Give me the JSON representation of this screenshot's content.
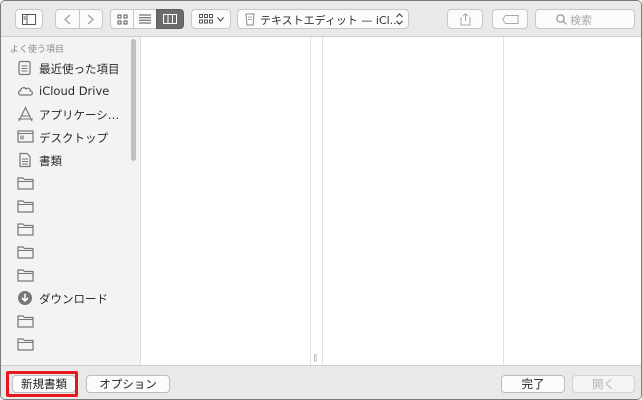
{
  "toolbar": {
    "path_label": "テキストエディット — iCl...",
    "search_placeholder": "検索"
  },
  "sidebar": {
    "header": "よく使う項目",
    "items": [
      {
        "label": "最近使った項目",
        "icon": "recents-icon"
      },
      {
        "label": "iCloud Drive",
        "icon": "cloud-icon"
      },
      {
        "label": "アプリケーシ…",
        "icon": "applications-icon"
      },
      {
        "label": "デスクトップ",
        "icon": "desktop-icon"
      },
      {
        "label": "書類",
        "icon": "documents-icon"
      },
      {
        "label": "",
        "icon": "folder-icon"
      },
      {
        "label": "",
        "icon": "folder-icon"
      },
      {
        "label": "",
        "icon": "folder-icon"
      },
      {
        "label": "",
        "icon": "folder-icon"
      },
      {
        "label": "",
        "icon": "folder-icon"
      },
      {
        "label": "ダウンロード",
        "icon": "downloads-icon"
      },
      {
        "label": "",
        "icon": "folder-icon"
      },
      {
        "label": "",
        "icon": "folder-icon"
      }
    ]
  },
  "bottom": {
    "new_document": "新規書類",
    "options": "オプション",
    "done": "完了",
    "open": "開く"
  },
  "colors": {
    "highlight": "#e8171d",
    "selected_view": "#6b6b6b"
  }
}
